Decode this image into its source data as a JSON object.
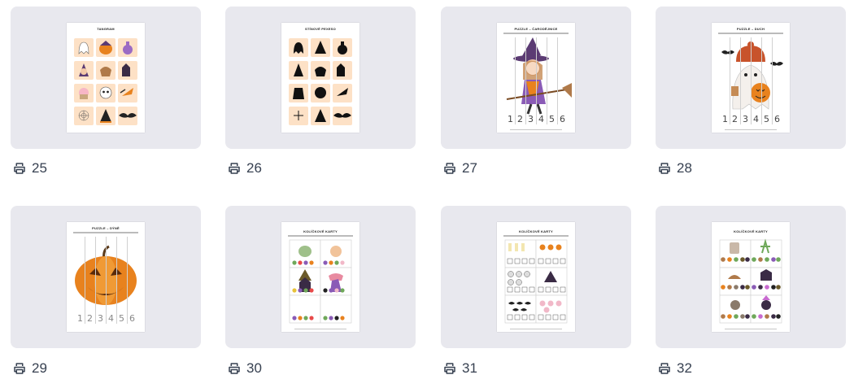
{
  "cards": [
    {
      "id": "25",
      "title": "TANGRAM",
      "kind": "tiles-color"
    },
    {
      "id": "26",
      "title": "STÍNOVÉ PEXESO",
      "kind": "tiles-shadow"
    },
    {
      "id": "27",
      "title": "PUZZLE – ČARODĚJNICE",
      "kind": "puzzle-witch"
    },
    {
      "id": "28",
      "title": "PUZZLE – DUCH",
      "kind": "puzzle-ghost"
    },
    {
      "id": "29",
      "title": "PUZZLE – DÝNĚ",
      "kind": "puzzle-pumpkin"
    },
    {
      "id": "30",
      "title": "KOLÍČKOVÉ KARTY",
      "kind": "clip-cards-colors"
    },
    {
      "id": "31",
      "title": "KOLÍČKOVÉ KARTY",
      "kind": "clip-cards-dice"
    },
    {
      "id": "32",
      "title": "KOLÍČKOVÉ KARTY",
      "kind": "clip-cards-count"
    }
  ],
  "puzzle_digits": [
    "1",
    "2",
    "3",
    "4",
    "5",
    "6"
  ],
  "icons": {
    "print": "printer-icon"
  },
  "colors": {
    "card_bg": "#e8e8ee",
    "tile_bg": "#fde1c6",
    "pumpkin": "#e8821e"
  }
}
